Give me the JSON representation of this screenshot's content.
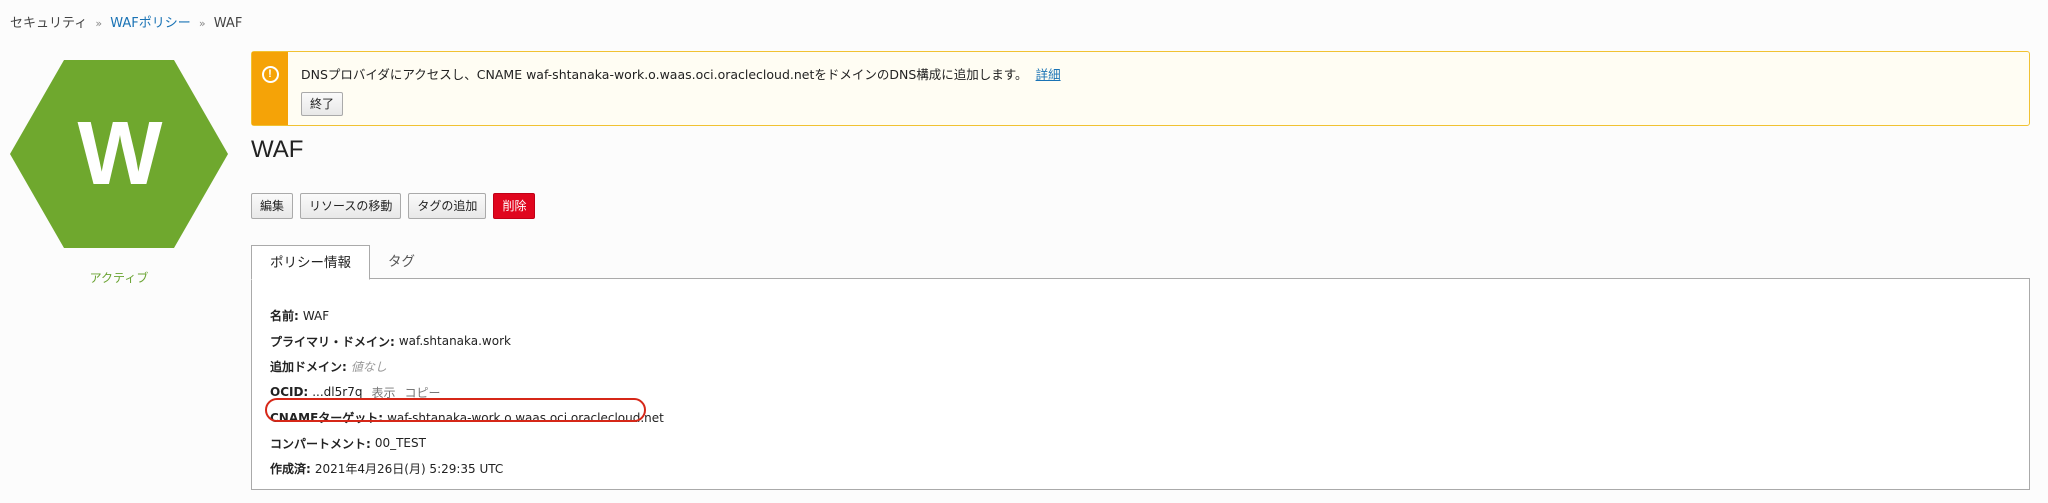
{
  "breadcrumb": {
    "items": [
      "セキュリティ",
      "WAFポリシー",
      "WAF"
    ],
    "separator": "»"
  },
  "resource": {
    "icon_letter": "W",
    "icon_color": "#6fa82e",
    "status": "アクティブ",
    "title": "WAF"
  },
  "alert": {
    "icon": "warning-icon",
    "message": "DNSプロバイダにアクセスし、CNAME waf-shtanaka-work.o.waas.oci.oraclecloud.netをドメインのDNS構成に追加します。",
    "link_label": "詳細",
    "button_label": "終了"
  },
  "actions": {
    "edit": "編集",
    "move": "リソースの移動",
    "add_tag": "タグの追加",
    "delete": "削除"
  },
  "tabs": [
    {
      "label": "ポリシー情報",
      "active": true
    },
    {
      "label": "タグ",
      "active": false
    }
  ],
  "info": {
    "name_label": "名前:",
    "name_value": "WAF",
    "primary_domain_label": "プライマリ・ドメイン:",
    "primary_domain_value": "waf.shtanaka.work",
    "additional_domain_label": "追加ドメイン:",
    "additional_domain_value": "値なし",
    "ocid_label": "OCID:",
    "ocid_value": "...dl5r7q",
    "ocid_show": "表示",
    "ocid_copy": "コピー",
    "cname_label": "CNAMEターゲット:",
    "cname_value": "waf-shtanaka-work.o.waas.oci.oraclecloud.net",
    "compartment_label": "コンパートメント:",
    "compartment_value": "00_TEST",
    "created_label": "作成済:",
    "created_value": "2021年4月26日(月) 5:29:35 UTC"
  },
  "colors": {
    "alert_stripe": "#f5a307",
    "danger": "#e0061e",
    "link": "#1a73b5",
    "highlight": "#d62718",
    "status": "#6aa332"
  }
}
